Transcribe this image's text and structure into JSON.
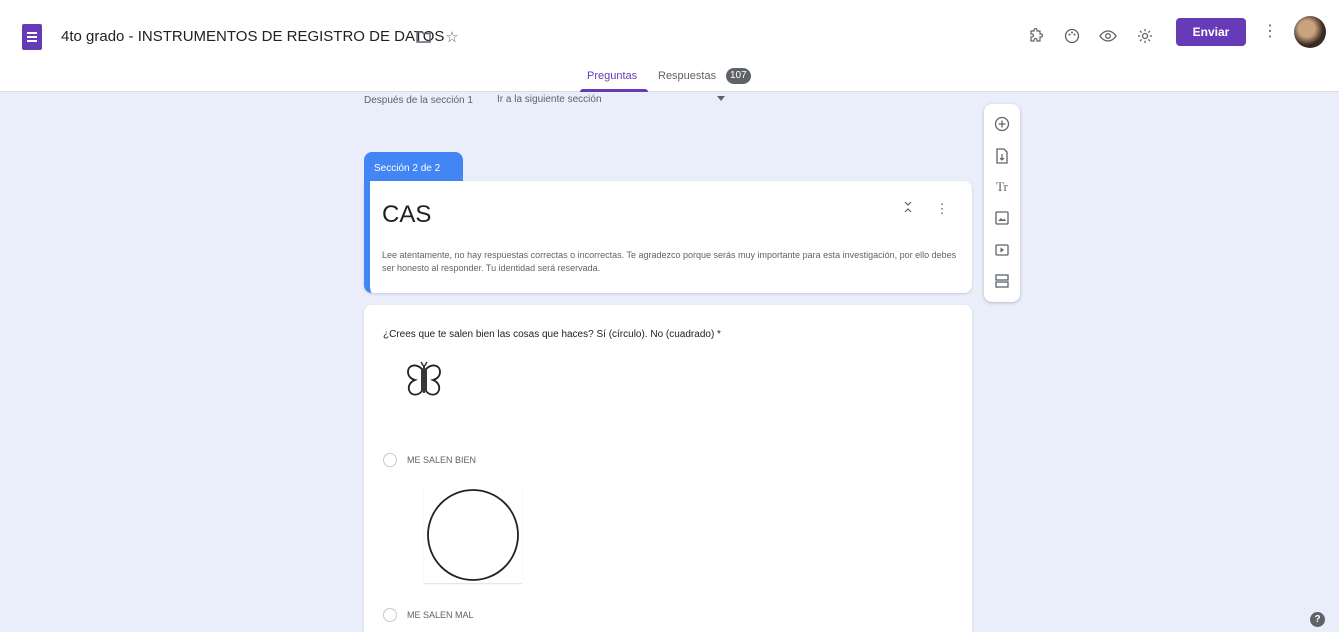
{
  "header": {
    "document_title": "4to grado - INSTRUMENTOS DE REGISTRO DE DATOS",
    "folder_icon": "folder-icon",
    "star_icon": "star-icon",
    "toolbar_icons": [
      "addon-icon",
      "palette-icon",
      "preview-eye-icon",
      "settings-gear-icon"
    ],
    "send_label": "Enviar",
    "more_icon": "more-vertical-icon",
    "brand_color": "#673ab7"
  },
  "tabs": {
    "questions_label": "Preguntas",
    "responses_label": "Respuestas",
    "responses_count": "107"
  },
  "section_nav": {
    "after_label": "Después de la sección 1",
    "after_value": "Ir a la siguiente sección"
  },
  "section": {
    "tab_label": "Sección 2 de 2",
    "title": "CAS",
    "description": "Lee atentamente, no hay respuestas correctas o incorrectas. Te agradezco porque serás muy importante para esta investigación, por ello debes ser honesto al responder. Tu identidad será reservada.",
    "accent_color": "#4285f4"
  },
  "question": {
    "text": "¿Crees que te salen bien las cosas que haces? Sí (círculo). No (cuadrado) *",
    "options": [
      {
        "label": "ME SALEN BIEN"
      },
      {
        "label": "ME SALEN MAL"
      }
    ]
  },
  "side_toolbar": {
    "icons": [
      "add-question-icon",
      "import-questions-icon",
      "add-title-icon",
      "add-image-icon",
      "add-video-icon",
      "add-section-icon"
    ],
    "title_glyph": "Tr"
  },
  "help_glyph": "?"
}
